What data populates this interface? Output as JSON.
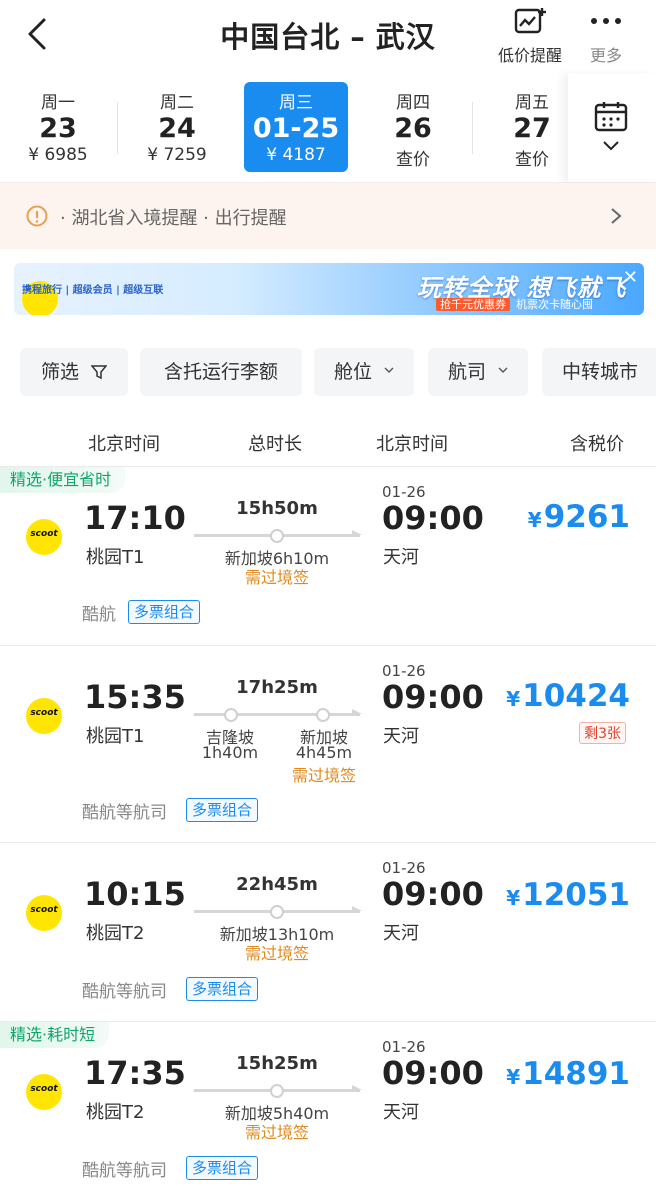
{
  "header": {
    "origin": "中国台北",
    "separator": "–",
    "destination": "武汉",
    "low_price_alert": "低价提醒",
    "more": "更多"
  },
  "dates": [
    {
      "weekday": "周一",
      "date": "23",
      "price": "¥ 6985"
    },
    {
      "weekday": "周二",
      "date": "24",
      "price": "¥ 7259"
    },
    {
      "weekday": "周三",
      "date": "01-25",
      "price": "¥ 4187",
      "selected": true
    },
    {
      "weekday": "周四",
      "date": "26",
      "price": "查价"
    },
    {
      "weekday": "周五",
      "date": "27",
      "price": "查价"
    }
  ],
  "notice": {
    "text": "· 湖北省入境提醒   · 出行提醒"
  },
  "banner": {
    "logo": "携程旅行 | 超级会员 | 超级互联",
    "headline": "玩转全球 想飞就飞",
    "coupon": "抢千元优惠券",
    "sub": "机票次卡随心囤"
  },
  "filters": {
    "filter": "筛选",
    "baggage": "含托运行李额",
    "cabin": "舱位",
    "airline": "航司",
    "transfer": "中转城市"
  },
  "columns": {
    "dep": "北京时间",
    "dur": "总时长",
    "arr": "北京时间",
    "price": "含税价"
  },
  "flights": [
    {
      "badge": "精选·便宜省时",
      "logo": "scoot",
      "dep_time": "17:10",
      "dep_airport": "桃园T1",
      "duration": "15h50m",
      "stops": [
        {
          "name": "新加坡6h10m"
        }
      ],
      "visa": "需过境签",
      "arr_date": "01-26",
      "arr_time": "09:00",
      "arr_airport": "天河",
      "price": "9261",
      "yen": "¥",
      "airline": "酷航",
      "tag": "多票组合"
    },
    {
      "logo": "scoot",
      "dep_time": "15:35",
      "dep_airport": "桃园T1",
      "duration": "17h25m",
      "stops": [
        {
          "name": "吉隆坡",
          "time": "1h40m"
        },
        {
          "name": "新加坡",
          "time": "4h45m"
        }
      ],
      "visa": "需过境签",
      "arr_date": "01-26",
      "arr_time": "09:00",
      "arr_airport": "天河",
      "price": "10424",
      "yen": "¥",
      "remaining": "剩3张",
      "airline": "酷航等航司",
      "tag": "多票组合"
    },
    {
      "logo": "scoot",
      "dep_time": "10:15",
      "dep_airport": "桃园T2",
      "duration": "22h45m",
      "stops": [
        {
          "name": "新加坡13h10m"
        }
      ],
      "visa": "需过境签",
      "arr_date": "01-26",
      "arr_time": "09:00",
      "arr_airport": "天河",
      "price": "12051",
      "yen": "¥",
      "airline": "酷航等航司",
      "tag": "多票组合"
    },
    {
      "badge": "精选·耗时短",
      "logo": "scoot",
      "dep_time": "17:35",
      "dep_airport": "桃园T2",
      "duration": "15h25m",
      "stops": [
        {
          "name": "新加坡5h40m"
        }
      ],
      "visa": "需过境签",
      "arr_date": "01-26",
      "arr_time": "09:00",
      "arr_airport": "天河",
      "price": "14891",
      "yen": "¥",
      "airline": "酷航等航司",
      "tag": "多票组合"
    }
  ],
  "colors": {
    "accent": "#1a8cf0",
    "badge_green": "#11a46b",
    "visa_orange": "#e08a1e",
    "logo_yellow": "#ffe500"
  },
  "icons": [
    "back-arrow-icon",
    "chart-plus-icon",
    "more-dots-icon",
    "calendar-icon",
    "chevron-down-icon",
    "info-icon",
    "chevron-right-icon",
    "filter-funnel-icon",
    "close-icon"
  ]
}
